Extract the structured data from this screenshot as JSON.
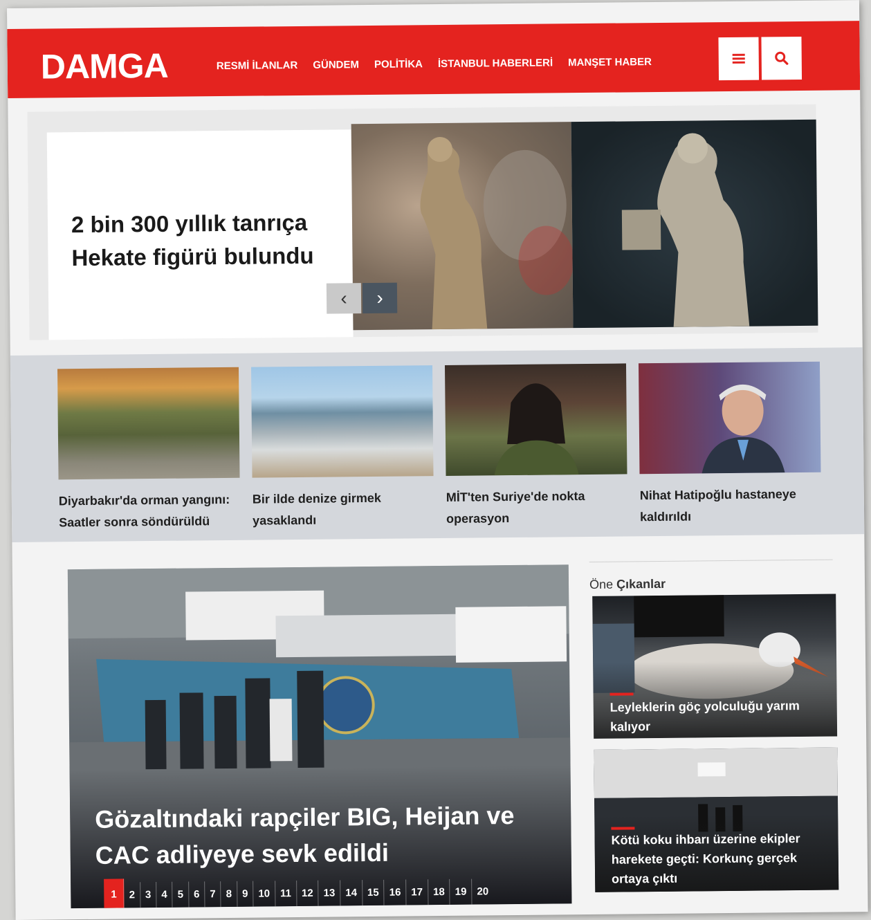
{
  "header": {
    "logo": "DAMGA",
    "nav": [
      "RESMİ İLANLAR",
      "GÜNDEM",
      "POLİTİKA",
      "İSTANBUL HABERLERİ",
      "MANŞET HABER"
    ],
    "menu_icon": "hamburger-icon",
    "search_icon": "search-icon",
    "brand_color": "#e4231f"
  },
  "hero": {
    "title": "2 bin 300 yıllık tanrıça Hekate figürü bulundu",
    "prev_arrow": "‹",
    "next_arrow": "›"
  },
  "news_row": [
    {
      "caption": "Diyarbakır'da orman yangını: Saatler sonra söndürüldü"
    },
    {
      "caption": "Bir ilde denize girmek yasaklandı"
    },
    {
      "caption": "MİT'ten Suriye'de nokta operasyon"
    },
    {
      "caption": "Nihat Hatipoğlu hastaneye kaldırıldı"
    }
  ],
  "main_story": {
    "title": "Gözaltındaki rapçiler BIG, Heijan ve CAC adliyeye sevk edildi",
    "pages": [
      "1",
      "2",
      "3",
      "4",
      "5",
      "6",
      "7",
      "8",
      "9",
      "10",
      "11",
      "12",
      "13",
      "14",
      "15",
      "16",
      "17",
      "18",
      "19",
      "20"
    ],
    "active_page": "1"
  },
  "sidebar": {
    "heading_prefix": "Öne",
    "heading_bold": "Çıkanlar",
    "items": [
      {
        "title": "Leyleklerin göç yolculuğu yarım kalıyor"
      },
      {
        "title": "Kötü koku ihbarı üzerine ekipler harekete geçti: Korkunç gerçek ortaya çıktı"
      }
    ]
  }
}
